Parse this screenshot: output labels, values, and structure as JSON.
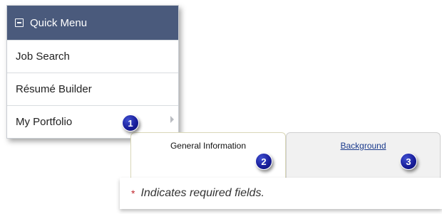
{
  "quick_menu": {
    "title": "Quick Menu",
    "items": [
      {
        "label": "Job Search"
      },
      {
        "label": "Résumé Builder"
      },
      {
        "label": "My Portfolio"
      }
    ]
  },
  "callouts": [
    "1",
    "2",
    "3"
  ],
  "tabs": [
    {
      "label": "General Information",
      "active": true
    },
    {
      "label": "Background",
      "active": false
    }
  ],
  "required_note": {
    "marker": "*",
    "text": "Indicates required fields."
  },
  "colors": {
    "menu_header": "#4a5a7c",
    "callout": "#1a1f9c",
    "link": "#1a3a8c",
    "required": "#c0262d"
  }
}
